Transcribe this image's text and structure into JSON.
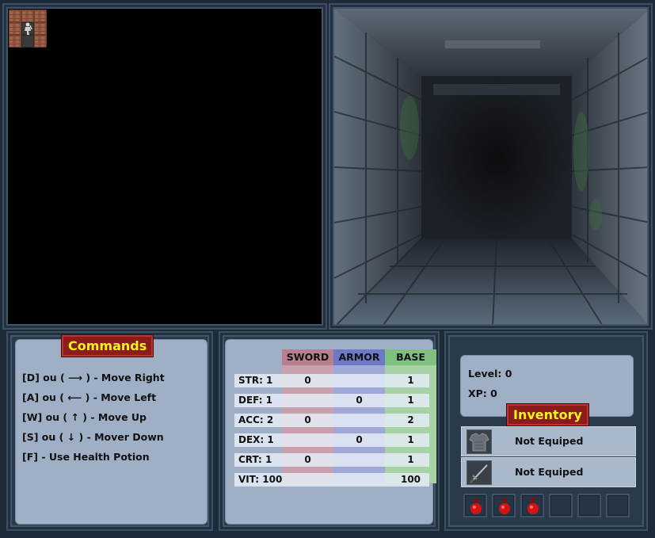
{
  "commands": {
    "title": "Commands",
    "lines": [
      "[D] ou ( ⟶ ) - Move Right",
      "[A] ou ( ⟵ ) - Move Left",
      "[W] ou  ( ↑ ) - Move Up",
      "[S] ou  ( ↓ ) - Mover Down",
      "[F] - Use Health Potion"
    ]
  },
  "stats": {
    "columns": [
      "SWORD",
      "ARMOR",
      "BASE"
    ],
    "column_colors": [
      "#c9a0ad",
      "#a0a8d8",
      "#a6d2a6"
    ],
    "rows": [
      {
        "name": "STR: 1",
        "sword": "0",
        "armor": "",
        "base": "1"
      },
      {
        "name": "DEF: 1",
        "sword": "",
        "armor": "0",
        "base": "1"
      },
      {
        "name": "ACC: 2",
        "sword": "0",
        "armor": "",
        "base": "2"
      },
      {
        "name": "DEX: 1",
        "sword": "",
        "armor": "0",
        "base": "1"
      },
      {
        "name": "CRT: 1",
        "sword": "0",
        "armor": "",
        "base": "1"
      },
      {
        "name": "VIT: 100",
        "sword": "",
        "armor": "",
        "base": "100"
      }
    ]
  },
  "character": {
    "level": "Level: 0",
    "xp": "XP: 0"
  },
  "inventory": {
    "title": "Inventory",
    "armor_slot": {
      "label": "Not Equiped",
      "icon": "armor-icon"
    },
    "weapon_slot": {
      "label": "Not Equiped",
      "icon": "sword-icon"
    },
    "potion_count": 3,
    "empty_slots": 3
  },
  "minimap": {
    "hero_icon": "hero-icon"
  }
}
